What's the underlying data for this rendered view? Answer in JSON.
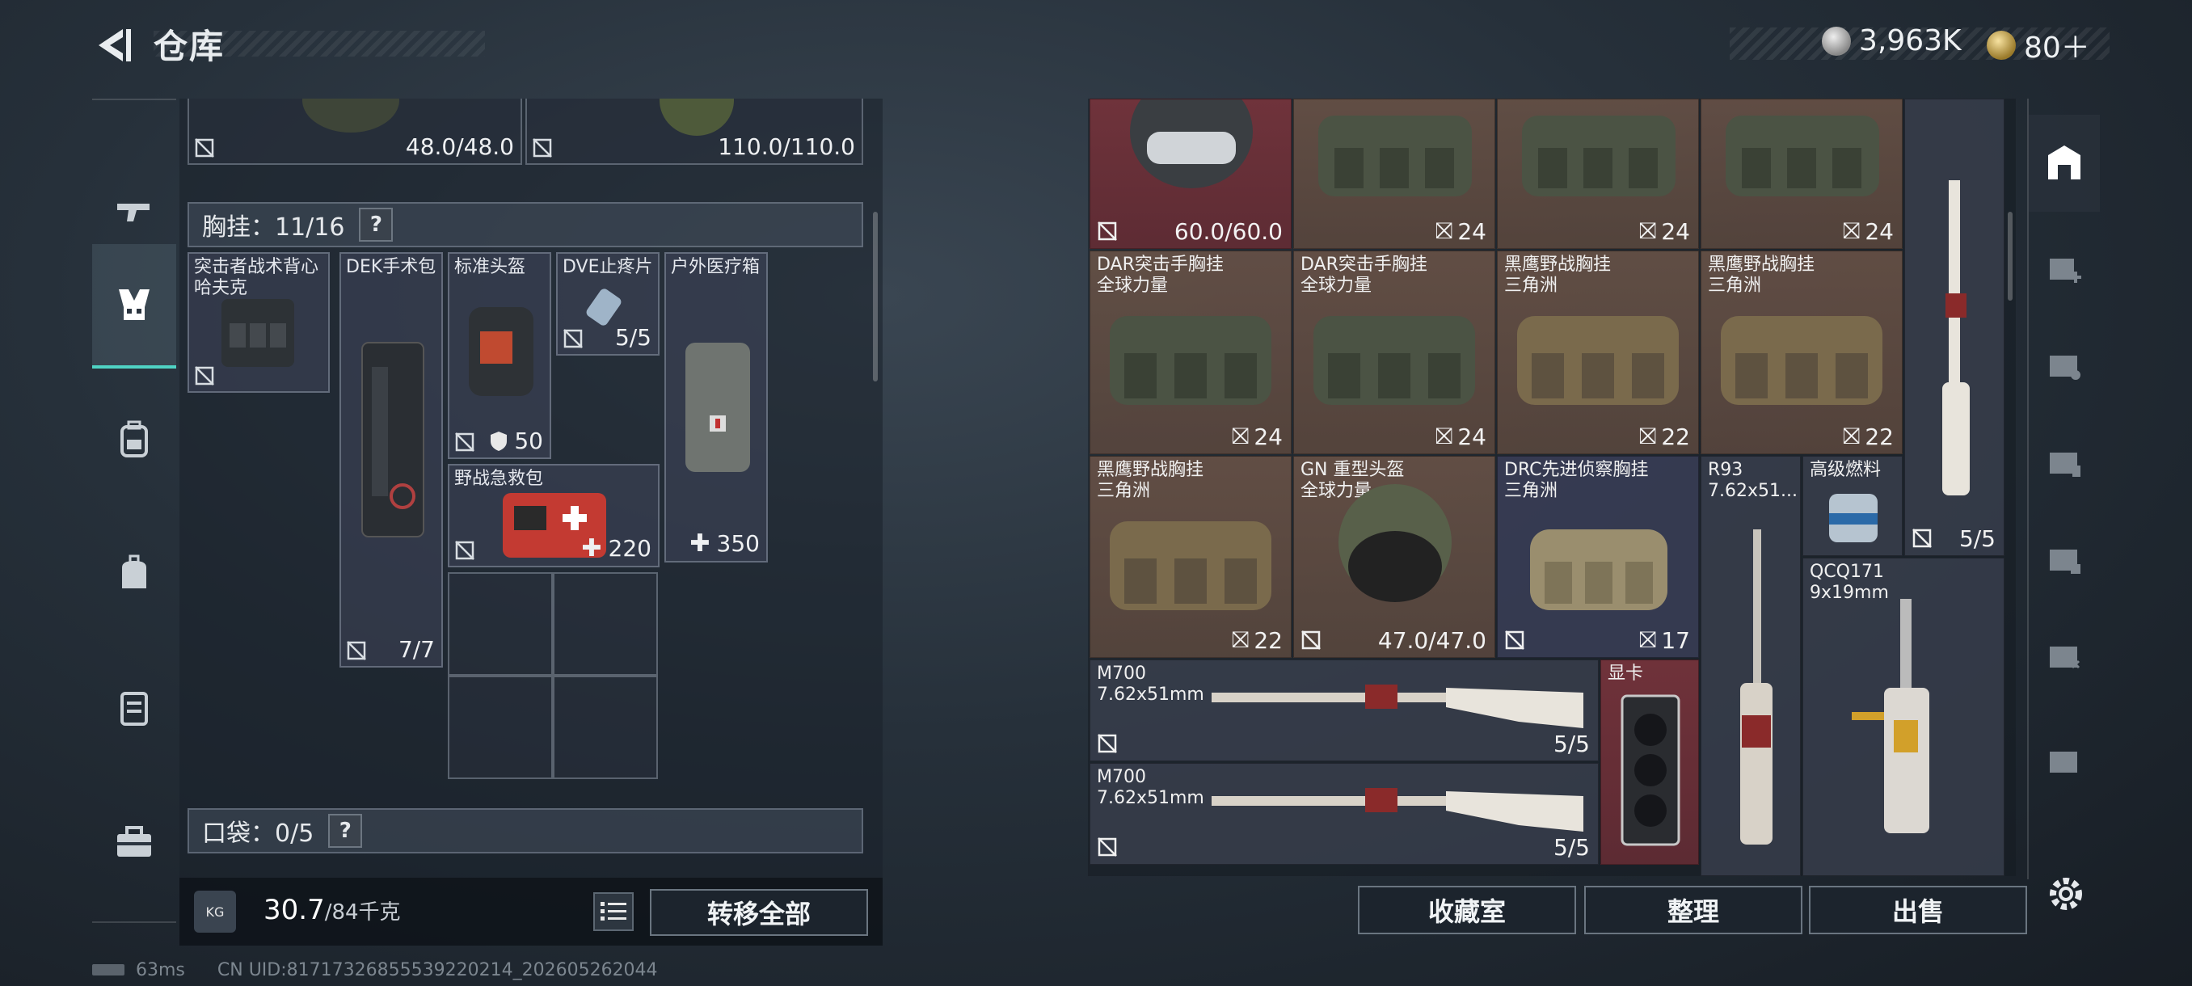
{
  "header": {
    "title": "仓库",
    "currency_1": "3,963K",
    "currency_2": "80＋"
  },
  "left_rail": {
    "items": [
      "gun-icon",
      "chest-rig-icon",
      "backpack-icon",
      "bag-icon",
      "case-icon",
      "toolbox-icon"
    ],
    "active": "chest-rig-icon"
  },
  "left_panel": {
    "top_items": [
      {
        "value": "48.0/48.0"
      },
      {
        "value": "110.0/110.0"
      }
    ],
    "chest_rig": {
      "label": "胸挂：11/16",
      "help": "?"
    },
    "items": [
      {
        "name": "突击者战术背心\n哈夫克"
      },
      {
        "name": "DEK手术包",
        "stat": "7/7"
      },
      {
        "name": "标准头盔",
        "stat": "50"
      },
      {
        "name": "DVE止疼片",
        "stat": "5/5"
      },
      {
        "name": "户外医疗箱",
        "stat": "350"
      },
      {
        "name": "野战急救包",
        "stat": "220"
      }
    ],
    "pocket": {
      "label": "口袋：0/5",
      "help": "?"
    }
  },
  "left_footer": {
    "weight_icon_label": "KG",
    "weight": "30.7",
    "weight_max": "/84千克",
    "transfer_all": "转移全部"
  },
  "right_panel": {
    "row1": [
      {
        "stat": "60.0/60.0"
      },
      {
        "stat": "24"
      },
      {
        "stat": "24"
      },
      {
        "stat": "24"
      }
    ],
    "row2": [
      {
        "name": "DAR突击手胸挂\n全球力量",
        "stat": "24"
      },
      {
        "name": "DAR突击手胸挂\n全球力量",
        "stat": "24"
      },
      {
        "name": "黑鹰野战胸挂\n三角洲",
        "stat": "22"
      },
      {
        "name": "黑鹰野战胸挂\n三角洲",
        "stat": "22"
      }
    ],
    "tall_rifle_stat": "5/5",
    "row3": [
      {
        "name": "黑鹰野战胸挂\n三角洲",
        "stat": "22"
      },
      {
        "name": "GN 重型头盔\n全球力量",
        "stat": "47.0/47.0"
      },
      {
        "name": "DRC先进侦察胸挂\n三角洲",
        "stat": "17"
      }
    ],
    "r93": {
      "name": "R93\n7.62x51..."
    },
    "fuel": {
      "name": "高级燃料"
    },
    "qcq": {
      "name": "QCQ171\n9x19mm"
    },
    "m700_a": {
      "name": "M700\n7.62x51mm",
      "stat": "5/5"
    },
    "m700_b": {
      "name": "M700\n7.62x51mm",
      "stat": "5/5"
    },
    "gpu": {
      "name": "显卡"
    }
  },
  "bottom_buttons": {
    "collection": "收藏室",
    "sort": "整理",
    "sell": "出售"
  },
  "status_bar": {
    "ping": "63ms",
    "uid": "CN UID:81717326855539220214_202605262044"
  }
}
